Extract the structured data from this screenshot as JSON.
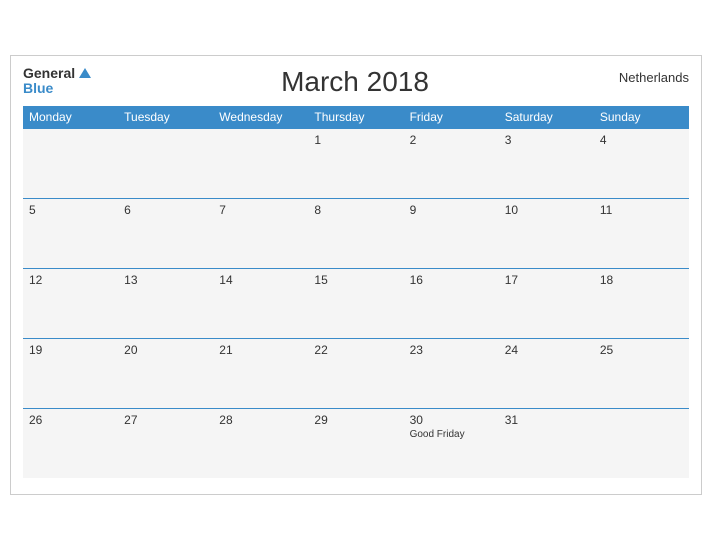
{
  "header": {
    "logo_general": "General",
    "logo_blue": "Blue",
    "title": "March 2018",
    "country": "Netherlands"
  },
  "weekdays": [
    "Monday",
    "Tuesday",
    "Wednesday",
    "Thursday",
    "Friday",
    "Saturday",
    "Sunday"
  ],
  "weeks": [
    [
      {
        "day": "",
        "empty": true
      },
      {
        "day": "",
        "empty": true
      },
      {
        "day": "",
        "empty": true
      },
      {
        "day": "1",
        "empty": false
      },
      {
        "day": "2",
        "empty": false
      },
      {
        "day": "3",
        "empty": false
      },
      {
        "day": "4",
        "empty": false
      }
    ],
    [
      {
        "day": "5",
        "empty": false
      },
      {
        "day": "6",
        "empty": false
      },
      {
        "day": "7",
        "empty": false
      },
      {
        "day": "8",
        "empty": false
      },
      {
        "day": "9",
        "empty": false
      },
      {
        "day": "10",
        "empty": false
      },
      {
        "day": "11",
        "empty": false
      }
    ],
    [
      {
        "day": "12",
        "empty": false
      },
      {
        "day": "13",
        "empty": false
      },
      {
        "day": "14",
        "empty": false
      },
      {
        "day": "15",
        "empty": false
      },
      {
        "day": "16",
        "empty": false
      },
      {
        "day": "17",
        "empty": false
      },
      {
        "day": "18",
        "empty": false
      }
    ],
    [
      {
        "day": "19",
        "empty": false
      },
      {
        "day": "20",
        "empty": false
      },
      {
        "day": "21",
        "empty": false
      },
      {
        "day": "22",
        "empty": false
      },
      {
        "day": "23",
        "empty": false
      },
      {
        "day": "24",
        "empty": false
      },
      {
        "day": "25",
        "empty": false
      }
    ],
    [
      {
        "day": "26",
        "empty": false
      },
      {
        "day": "27",
        "empty": false
      },
      {
        "day": "28",
        "empty": false
      },
      {
        "day": "29",
        "empty": false
      },
      {
        "day": "30",
        "holiday": "Good Friday",
        "empty": false
      },
      {
        "day": "31",
        "empty": false
      },
      {
        "day": "",
        "empty": true
      }
    ]
  ]
}
